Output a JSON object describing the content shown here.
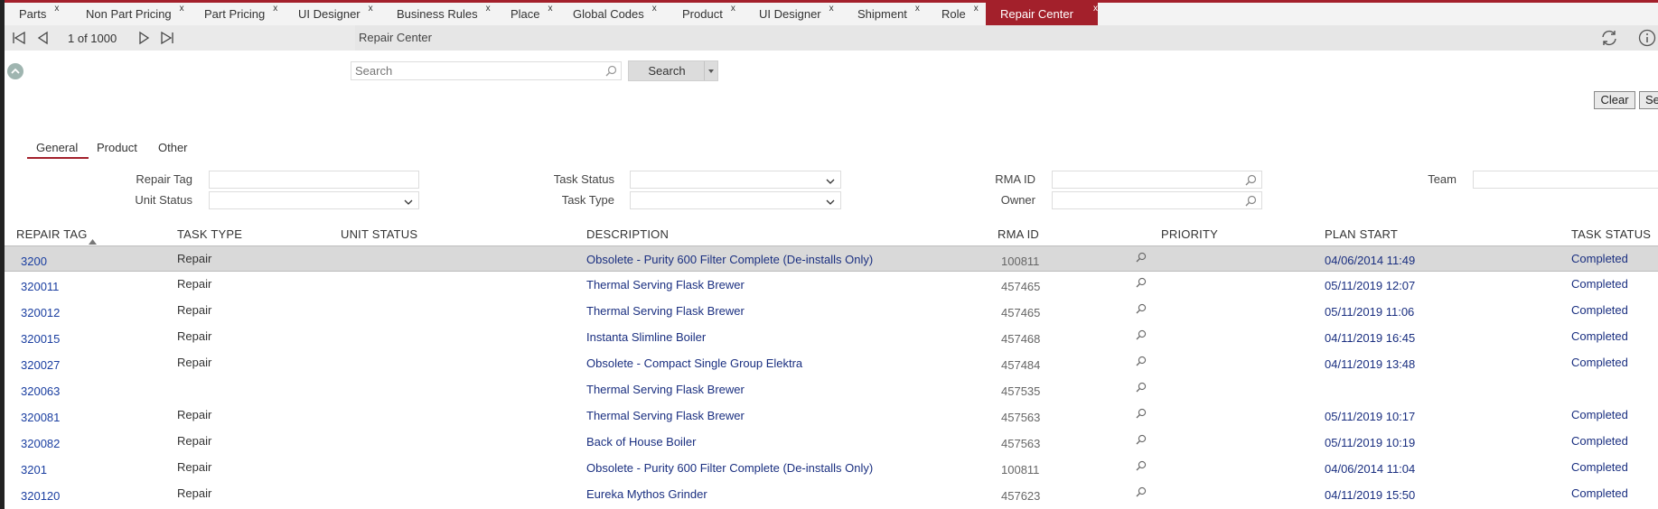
{
  "tabs": [
    {
      "label": "Parts",
      "close": "x"
    },
    {
      "label": "Non Part Pricing",
      "close": "x"
    },
    {
      "label": "Part Pricing",
      "close": "x"
    },
    {
      "label": "UI Designer",
      "close": "x"
    },
    {
      "label": "Business Rules",
      "close": "x"
    },
    {
      "label": "Place",
      "close": "x"
    },
    {
      "label": "Global Codes",
      "close": "x"
    },
    {
      "label": "Product",
      "close": "x"
    },
    {
      "label": "UI Designer",
      "close": "x"
    },
    {
      "label": "Shipment",
      "close": "x"
    },
    {
      "label": "Role",
      "close": "x"
    },
    {
      "label": "Repair Center",
      "close": "x"
    }
  ],
  "active_tab_index": 11,
  "pager": {
    "text": "1 of 1000"
  },
  "pane_title": "Repair Center",
  "search": {
    "placeholder": "Search",
    "button_label": "Search"
  },
  "actions": {
    "clear_label": "Clear",
    "second_label": "Se"
  },
  "subtabs": [
    "General",
    "Product",
    "Other"
  ],
  "filters": {
    "repair_tag": "Repair Tag",
    "unit_status": "Unit Status",
    "task_status": "Task Status",
    "task_type": "Task Type",
    "rma_id": "RMA ID",
    "owner": "Owner",
    "team": "Team"
  },
  "columns": [
    "REPAIR TAG",
    "TASK TYPE",
    "UNIT STATUS",
    "DESCRIPTION",
    "RMA ID",
    "PRIORITY",
    "PLAN START",
    "TASK STATUS"
  ],
  "rows": [
    {
      "tag": "3200",
      "type": "Repair",
      "desc": "Obsolete - Purity 600 Filter Complete (De-installs Only)",
      "rma": "100811",
      "start": "04/06/2014 11:49",
      "status": "Completed"
    },
    {
      "tag": "320011",
      "type": "Repair",
      "desc": "Thermal Serving Flask Brewer",
      "rma": "457465",
      "start": "05/11/2019 12:07",
      "status": "Completed"
    },
    {
      "tag": "320012",
      "type": "Repair",
      "desc": "Thermal Serving Flask Brewer",
      "rma": "457465",
      "start": "05/11/2019 11:06",
      "status": "Completed"
    },
    {
      "tag": "320015",
      "type": "Repair",
      "desc": "Instanta Slimline Boiler",
      "rma": "457468",
      "start": "04/11/2019 16:45",
      "status": "Completed"
    },
    {
      "tag": "320027",
      "type": "Repair",
      "desc": "Obsolete - Compact Single Group Elektra",
      "rma": "457484",
      "start": "04/11/2019 13:48",
      "status": "Completed"
    },
    {
      "tag": "320063",
      "type": "",
      "desc": "Thermal Serving Flask Brewer",
      "rma": "457535",
      "start": "",
      "status": ""
    },
    {
      "tag": "320081",
      "type": "Repair",
      "desc": "Thermal Serving Flask Brewer",
      "rma": "457563",
      "start": "05/11/2019 10:17",
      "status": "Completed"
    },
    {
      "tag": "320082",
      "type": "Repair",
      "desc": "Back of House Boiler",
      "rma": "457563",
      "start": "05/11/2019 10:19",
      "status": "Completed"
    },
    {
      "tag": "3201",
      "type": "Repair",
      "desc": "Obsolete - Purity 600 Filter Complete (De-installs Only)",
      "rma": "100811",
      "start": "04/06/2014 11:04",
      "status": "Completed"
    },
    {
      "tag": "320120",
      "type": "Repair",
      "desc": "Eureka Mythos Grinder",
      "rma": "457623",
      "start": "04/11/2019 15:50",
      "status": "Completed"
    }
  ],
  "colors": {
    "accent": "#a3202b",
    "link": "#1a3ea0"
  }
}
